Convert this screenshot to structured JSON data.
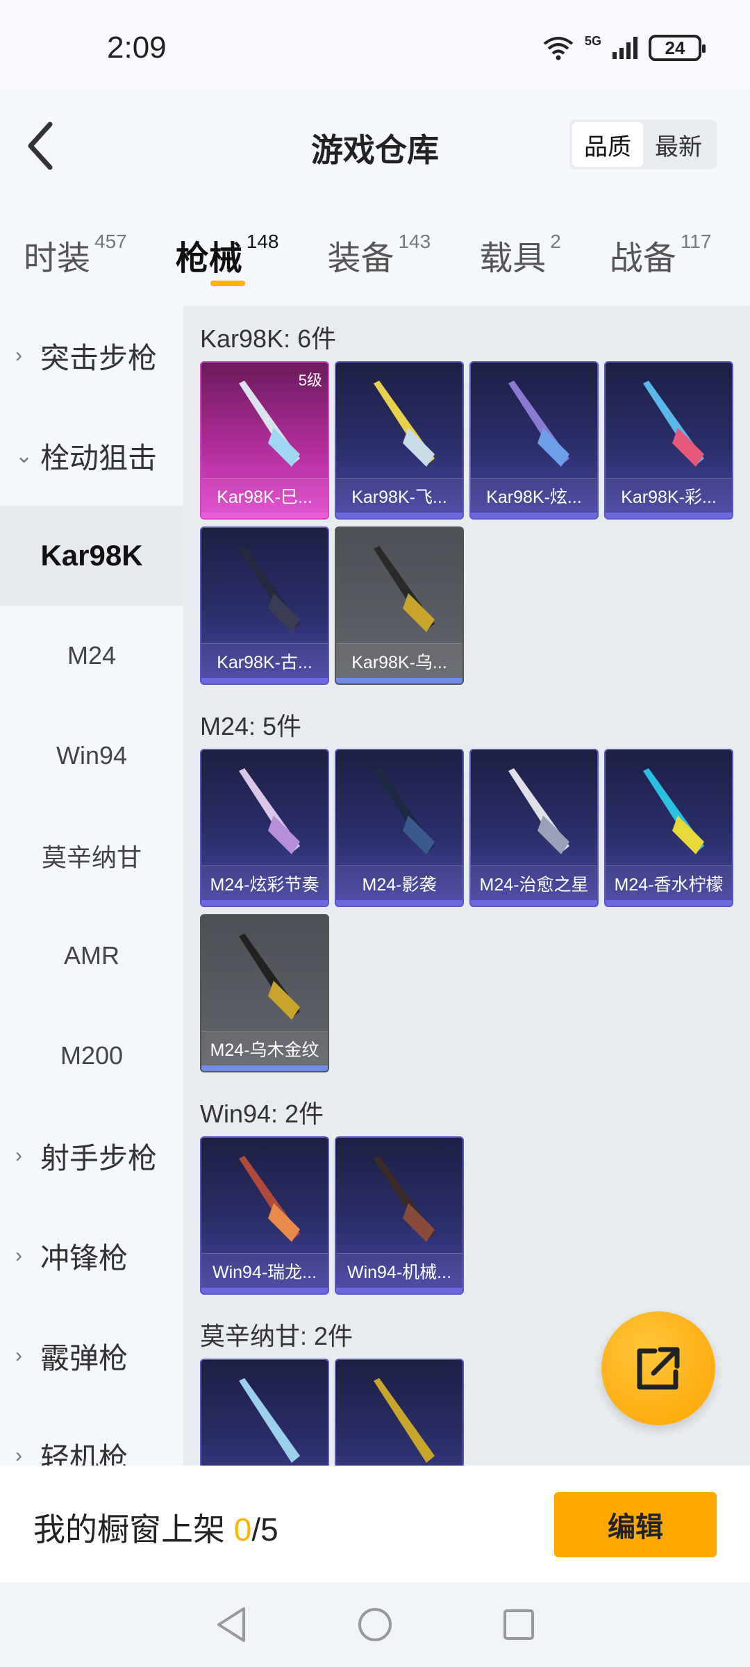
{
  "status": {
    "time": "2:09",
    "network": "5G",
    "battery": "24"
  },
  "header": {
    "title": "游戏仓库",
    "sort": [
      "品质",
      "最新"
    ]
  },
  "tabs": [
    {
      "label": "时装",
      "count": "457"
    },
    {
      "label": "枪械",
      "count": "148"
    },
    {
      "label": "装备",
      "count": "143"
    },
    {
      "label": "载具",
      "count": "2"
    },
    {
      "label": "战备",
      "count": "117"
    }
  ],
  "sidebar": {
    "cat1": "突击步枪",
    "cat2": "栓动狙击",
    "subs": [
      "Kar98K",
      "M24",
      "Win94",
      "莫辛纳甘",
      "AMR",
      "M200"
    ],
    "cat3": "射手步枪",
    "cat4": "冲锋枪",
    "cat5": "霰弹枪",
    "cat6": "轻机枪"
  },
  "groups": [
    {
      "title": "Kar98K: 6件",
      "items": [
        {
          "name": "Kar98K-巳...",
          "level": "5级"
        },
        {
          "name": "Kar98K-飞..."
        },
        {
          "name": "Kar98K-炫..."
        },
        {
          "name": "Kar98K-彩..."
        },
        {
          "name": "Kar98K-古..."
        },
        {
          "name": "Kar98K-乌..."
        }
      ]
    },
    {
      "title": "M24: 5件",
      "items": [
        {
          "name": "M24-炫彩节奏"
        },
        {
          "name": "M24-影袭"
        },
        {
          "name": "M24-治愈之星"
        },
        {
          "name": "M24-香水柠檬"
        },
        {
          "name": "M24-乌木金纹"
        }
      ]
    },
    {
      "title": "Win94: 2件",
      "items": [
        {
          "name": "Win94-瑞龙..."
        },
        {
          "name": "Win94-机械..."
        }
      ]
    },
    {
      "title": "莫辛纳甘: 2件",
      "items": [
        {
          "name": ""
        },
        {
          "name": ""
        }
      ]
    }
  ],
  "bottom": {
    "label": "我的橱窗上架 ",
    "current": "0",
    "total": "/5",
    "edit": "编辑"
  },
  "colors": {
    "accent": "#ffa800",
    "pink_card": "#d642c5",
    "purple_card": "#5b58c6"
  }
}
